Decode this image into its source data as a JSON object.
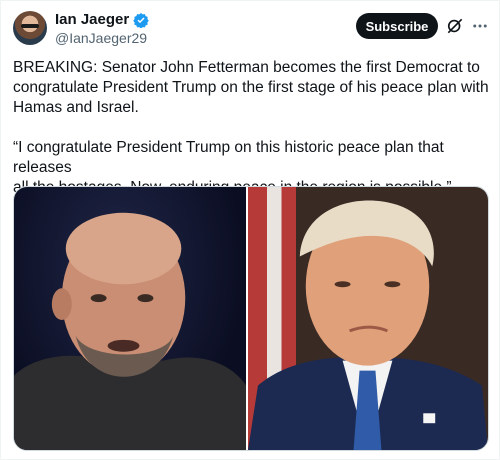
{
  "author": {
    "display_name": "Ian Jaeger",
    "handle": "@IanJaeger29",
    "verified": true,
    "avatar_icon": "user-avatar-photo"
  },
  "actions": {
    "subscribe_label": "Subscribe",
    "grok_icon": "grok-icon",
    "more_icon": "more-horizontal-icon"
  },
  "post": {
    "paragraph_1": "BREAKING: Senator John Fetterman becomes the first Democrat to\ncongratulate President Trump on the first stage of his peace plan with\nHamas and Israel.",
    "paragraph_2": "“I congratulate President Trump on this historic peace plan that releases\nall the hostages. Now, enduring peace in the region is possible.”"
  },
  "media": {
    "images": [
      {
        "subject": "portrait-photo-left"
      },
      {
        "subject": "portrait-photo-right"
      }
    ]
  },
  "colors": {
    "text": "#0f1419",
    "secondary_text": "#536471",
    "verified_blue": "#1d9bf0",
    "button_bg": "#0f1419"
  }
}
